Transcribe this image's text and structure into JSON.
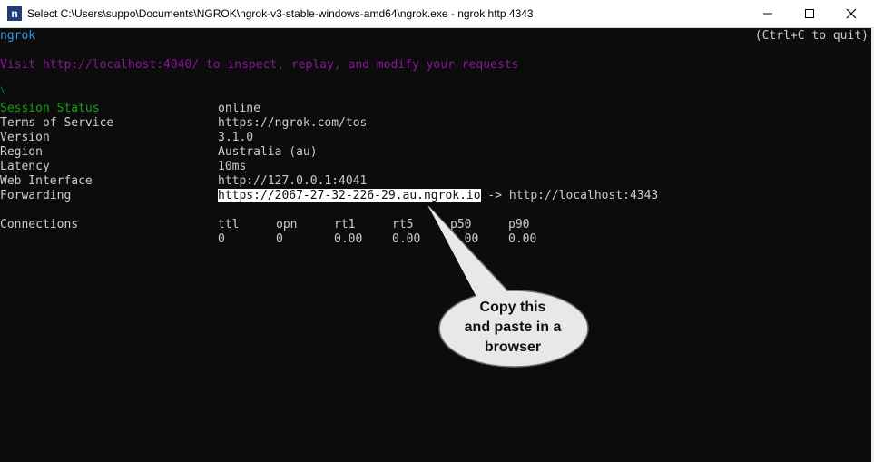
{
  "window": {
    "icon_letter": "n",
    "title": "Select C:\\Users\\suppo\\Documents\\NGROK\\ngrok-v3-stable-windows-amd64\\ngrok.exe - ngrok  http 4343"
  },
  "console": {
    "app_name": "ngrok",
    "quit_hint": "(Ctrl+C to quit)",
    "visit_message": "Visit http://localhost:4040/ to inspect, replay, and modify your requests",
    "stray_char": "\\",
    "rows": [
      {
        "label": "Session Status",
        "value": "online"
      },
      {
        "label": "Terms of Service",
        "value": "https://ngrok.com/tos"
      },
      {
        "label": "Version",
        "value": "3.1.0"
      },
      {
        "label": "Region",
        "value": "Australia (au)"
      },
      {
        "label": "Latency",
        "value": "10ms"
      },
      {
        "label": "Web Interface",
        "value": "http://127.0.0.1:4041"
      }
    ],
    "forwarding": {
      "label": "Forwarding",
      "public_url": "https://2067-27-32-226-29.au.ngrok.io",
      "arrow_target": " -> http://localhost:4343"
    },
    "connections": {
      "label": "Connections",
      "headers": [
        "ttl",
        "opn",
        "rt1",
        "rt5",
        "p50",
        "p90"
      ],
      "values": [
        "0",
        "0",
        "0.00",
        "0.00",
        "0.00",
        "0.00"
      ]
    }
  },
  "callout": {
    "lines": [
      "Copy this",
      "and paste in a",
      "browser"
    ]
  },
  "colors": {
    "console_bg": "#0c0c0c",
    "text": "#cccccc",
    "teal": "#3a96dd",
    "purple": "#881798",
    "green": "#13a10e",
    "callout_fill": "#e8e8e8"
  }
}
